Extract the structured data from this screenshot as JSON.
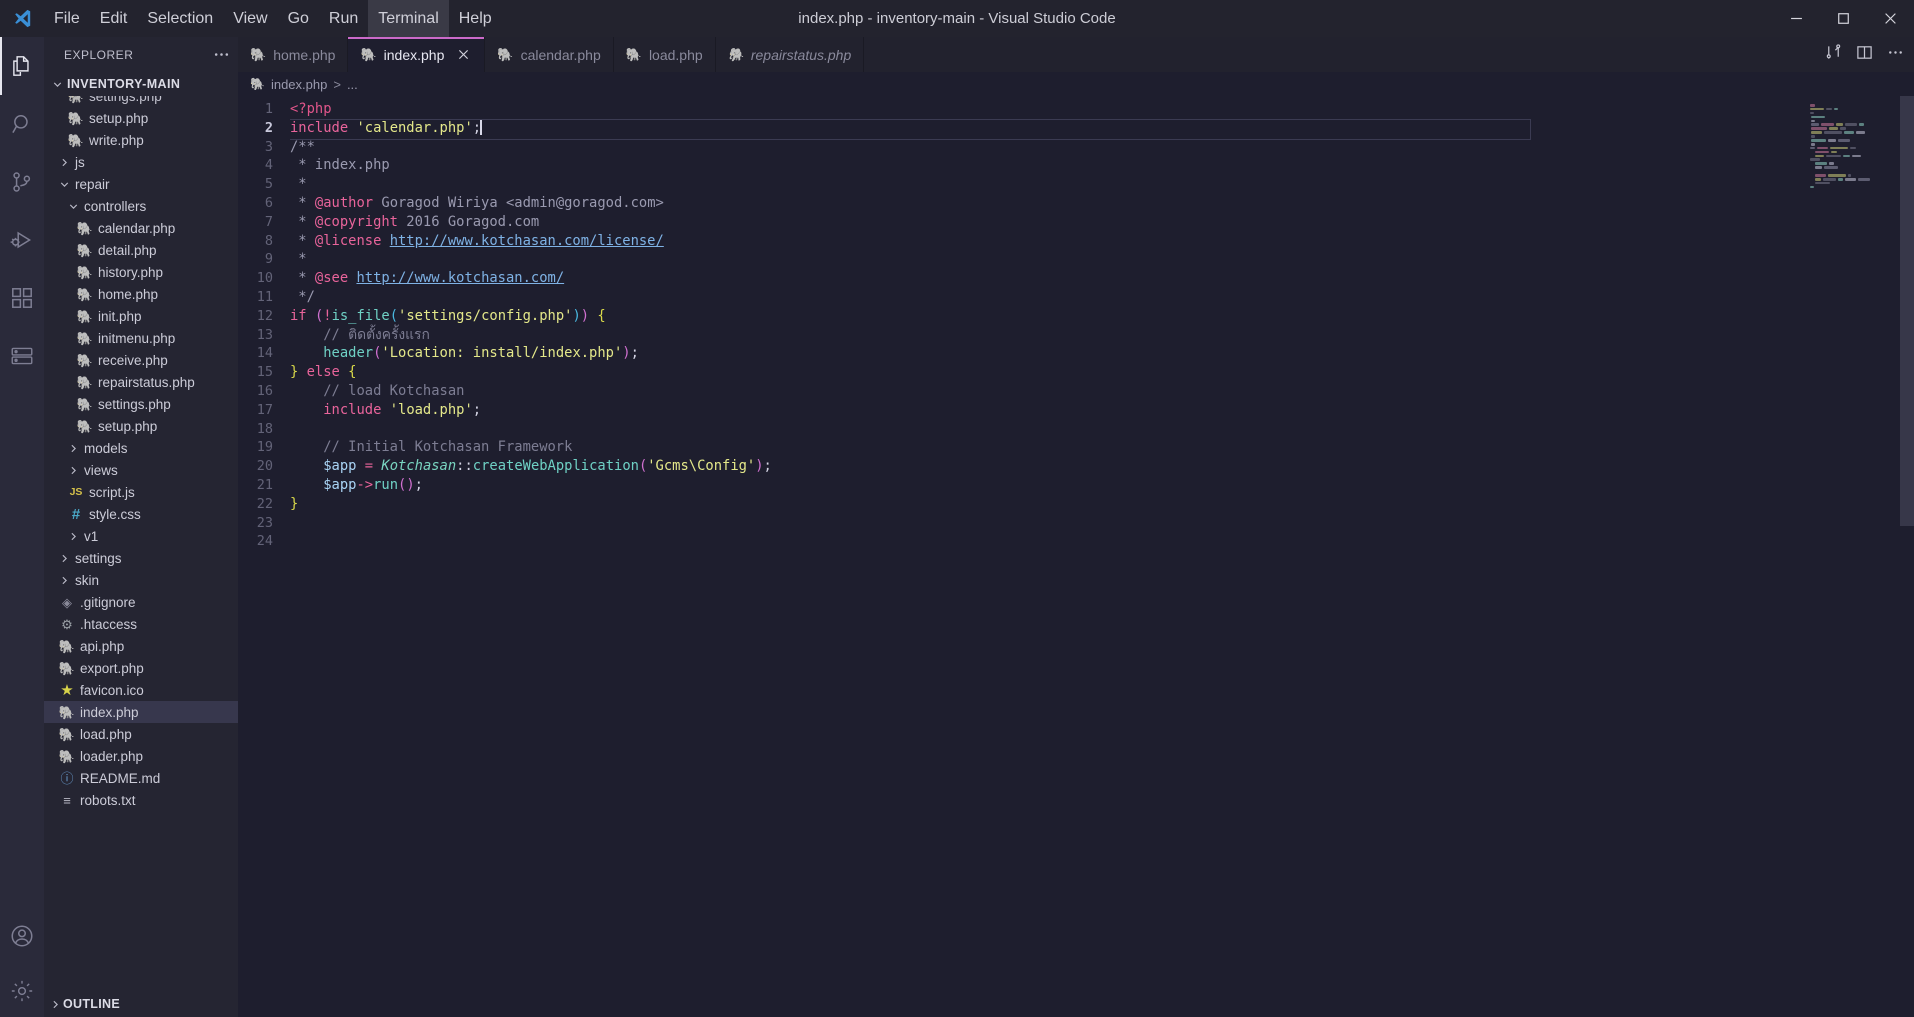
{
  "window": {
    "title": "index.php - inventory-main - Visual Studio Code",
    "logo_icon": "vscode-logo",
    "minimize_label": "Minimize",
    "maximize_label": "Maximize",
    "close_label": "Close"
  },
  "menubar": {
    "items": [
      {
        "label": "File",
        "active": false
      },
      {
        "label": "Edit",
        "active": false
      },
      {
        "label": "Selection",
        "active": false
      },
      {
        "label": "View",
        "active": false
      },
      {
        "label": "Go",
        "active": false
      },
      {
        "label": "Run",
        "active": false
      },
      {
        "label": "Terminal",
        "active": true
      },
      {
        "label": "Help",
        "active": false
      }
    ]
  },
  "activitybar": {
    "items": [
      {
        "name": "explorer-icon",
        "label": "Explorer",
        "active": true
      },
      {
        "name": "search-icon",
        "label": "Search",
        "active": false
      },
      {
        "name": "source-control-icon",
        "label": "Source Control",
        "active": false
      },
      {
        "name": "run-debug-icon",
        "label": "Run and Debug",
        "active": false
      },
      {
        "name": "extensions-icon",
        "label": "Extensions",
        "active": false
      },
      {
        "name": "remote-explorer-icon",
        "label": "Remote Explorer",
        "active": false
      }
    ],
    "bottom": [
      {
        "name": "accounts-icon",
        "label": "Accounts"
      },
      {
        "name": "settings-gear-icon",
        "label": "Manage"
      }
    ]
  },
  "sidebar": {
    "header_title": "EXPLORER",
    "more_actions_icon": "ellipsis-icon",
    "root_folder": "INVENTORY-MAIN",
    "outline_label": "OUTLINE",
    "tree": [
      {
        "label": "settings.php",
        "icon": "php",
        "kind": "file",
        "depth": 3,
        "clipped": true
      },
      {
        "label": "setup.php",
        "icon": "php",
        "kind": "file",
        "depth": 3
      },
      {
        "label": "write.php",
        "icon": "php",
        "kind": "file",
        "depth": 3
      },
      {
        "label": "js",
        "icon": "folder",
        "kind": "folder",
        "depth": 2,
        "expanded": false
      },
      {
        "label": "repair",
        "icon": "folder",
        "kind": "folder",
        "depth": 2,
        "expanded": true
      },
      {
        "label": "controllers",
        "icon": "folder",
        "kind": "folder",
        "depth": 3,
        "expanded": true
      },
      {
        "label": "calendar.php",
        "icon": "php",
        "kind": "file",
        "depth": 4
      },
      {
        "label": "detail.php",
        "icon": "php",
        "kind": "file",
        "depth": 4
      },
      {
        "label": "history.php",
        "icon": "php",
        "kind": "file",
        "depth": 4
      },
      {
        "label": "home.php",
        "icon": "php",
        "kind": "file",
        "depth": 4
      },
      {
        "label": "init.php",
        "icon": "php",
        "kind": "file",
        "depth": 4
      },
      {
        "label": "initmenu.php",
        "icon": "php",
        "kind": "file",
        "depth": 4
      },
      {
        "label": "receive.php",
        "icon": "php",
        "kind": "file",
        "depth": 4
      },
      {
        "label": "repairstatus.php",
        "icon": "php",
        "kind": "file",
        "depth": 4
      },
      {
        "label": "settings.php",
        "icon": "php",
        "kind": "file",
        "depth": 4
      },
      {
        "label": "setup.php",
        "icon": "php",
        "kind": "file",
        "depth": 4
      },
      {
        "label": "models",
        "icon": "folder",
        "kind": "folder",
        "depth": 3,
        "expanded": false
      },
      {
        "label": "views",
        "icon": "folder",
        "kind": "folder",
        "depth": 3,
        "expanded": false
      },
      {
        "label": "script.js",
        "icon": "js",
        "kind": "file",
        "depth": 3
      },
      {
        "label": "style.css",
        "icon": "css",
        "kind": "file",
        "depth": 3
      },
      {
        "label": "v1",
        "icon": "folder",
        "kind": "folder",
        "depth": 3,
        "expanded": false
      },
      {
        "label": "settings",
        "icon": "folder",
        "kind": "folder",
        "depth": 2,
        "expanded": false
      },
      {
        "label": "skin",
        "icon": "folder",
        "kind": "folder",
        "depth": 2,
        "expanded": false
      },
      {
        "label": ".gitignore",
        "icon": "git",
        "kind": "file",
        "depth": 2
      },
      {
        "label": ".htaccess",
        "icon": "config",
        "kind": "file",
        "depth": 2
      },
      {
        "label": "api.php",
        "icon": "php",
        "kind": "file",
        "depth": 2
      },
      {
        "label": "export.php",
        "icon": "php",
        "kind": "file",
        "depth": 2
      },
      {
        "label": "favicon.ico",
        "icon": "star",
        "kind": "file",
        "depth": 2
      },
      {
        "label": "index.php",
        "icon": "php",
        "kind": "file",
        "depth": 2,
        "selected": true
      },
      {
        "label": "load.php",
        "icon": "php",
        "kind": "file",
        "depth": 2
      },
      {
        "label": "loader.php",
        "icon": "php",
        "kind": "file",
        "depth": 2
      },
      {
        "label": "README.md",
        "icon": "md",
        "kind": "file",
        "depth": 2
      },
      {
        "label": "robots.txt",
        "icon": "txt",
        "kind": "file",
        "depth": 2
      }
    ]
  },
  "tabs": {
    "items": [
      {
        "label": "home.php",
        "icon": "php",
        "active": false,
        "preview": false,
        "closable": false
      },
      {
        "label": "index.php",
        "icon": "php",
        "active": true,
        "preview": false,
        "closable": true
      },
      {
        "label": "calendar.php",
        "icon": "php",
        "active": false,
        "preview": false,
        "closable": false
      },
      {
        "label": "load.php",
        "icon": "php",
        "active": false,
        "preview": false,
        "closable": false
      },
      {
        "label": "repairstatus.php",
        "icon": "php",
        "active": false,
        "preview": true,
        "closable": false
      }
    ],
    "actions": [
      {
        "name": "split-editor-right-icon",
        "label": "Split Editor Right"
      },
      {
        "name": "open-changes-icon",
        "label": "Open Changes"
      },
      {
        "name": "more-actions-icon",
        "label": "More Actions..."
      }
    ]
  },
  "breadcrumbs": {
    "file_icon": "php",
    "file": "index.php",
    "separator": ">",
    "trailing": "..."
  },
  "editor": {
    "active_line": 2,
    "total_lines": 24,
    "cursor_line": 2,
    "line_numbers": [
      "1",
      "2",
      "3",
      "4",
      "5",
      "6",
      "7",
      "8",
      "9",
      "10",
      "11",
      "12",
      "13",
      "14",
      "15",
      "16",
      "17",
      "18",
      "19",
      "20",
      "21",
      "22",
      "23",
      "24"
    ],
    "code_lines": [
      "<?php",
      "include 'calendar.php';",
      "/**",
      " * index.php",
      " *",
      " * @author Goragod Wiriya <admin@goragod.com>",
      " * @copyright 2016 Goragod.com",
      " * @license http://www.kotchasan.com/license/",
      " *",
      " * @see http://www.kotchasan.com/",
      " */",
      "if (!is_file('settings/config.php')) {",
      "    // ติดตั้งครั้งแรก",
      "    header('Location: install/index.php');",
      "} else {",
      "    // load Kotchasan",
      "    include 'load.php';",
      "",
      "    // Initial Kotchasan Framework",
      "    $app = Kotchasan::createWebApplication('Gcms\\\\Config');",
      "    $app->run();",
      "}",
      "",
      ""
    ]
  },
  "colors": {
    "accent": "#cb6ac9",
    "titlebar_bg": "#23232e",
    "sidebar_bg": "#252532",
    "activitybar_bg": "#2a2a3a",
    "editor_bg": "#1e1e2e",
    "tab_active_bg": "#1e1e2e",
    "selection_bg": "#37374d",
    "php_icon": "#a97fd6",
    "string": "#e4e88a",
    "keyword": "#e9649b",
    "comment": "#7d7d93",
    "function": "#6fd1c5",
    "link": "#7fb2e5"
  }
}
